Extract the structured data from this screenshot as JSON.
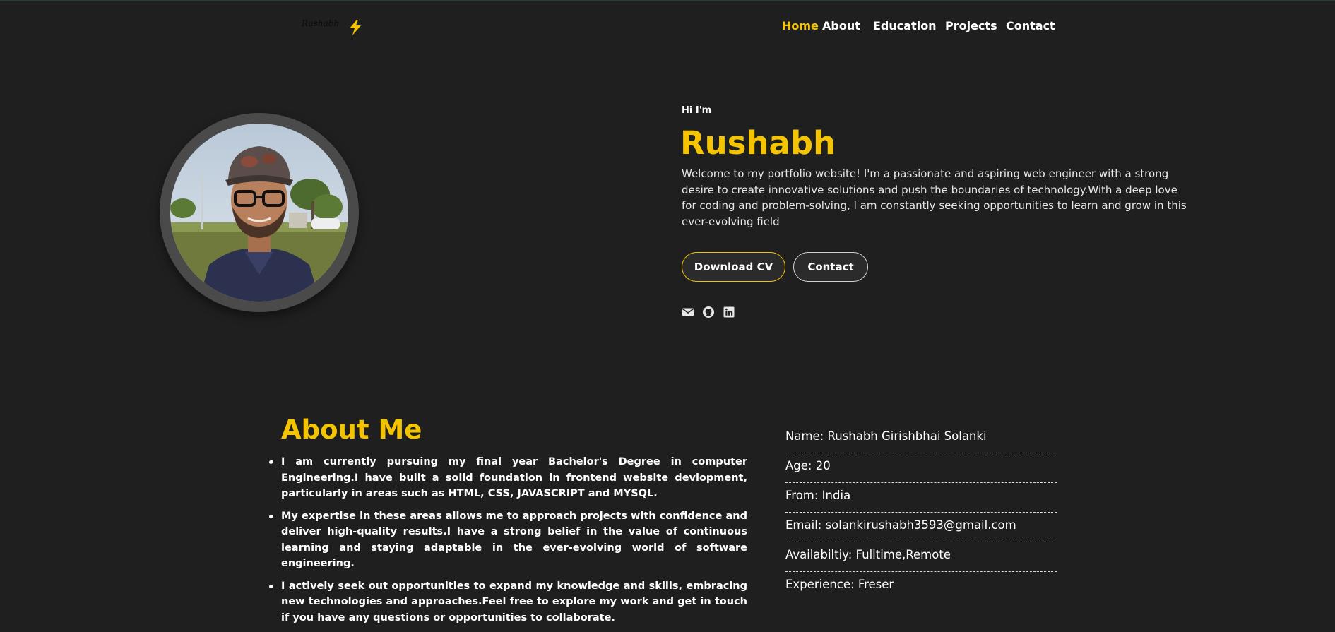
{
  "nav": {
    "logo_text": "Rushabh",
    "logo_icon": "lightning-bolt-icon",
    "links": [
      "Home",
      "About",
      "Education",
      "Projects",
      "Contact"
    ],
    "active": "Home"
  },
  "hero": {
    "greeting": "Hi I'm",
    "name": "Rushabh",
    "description": "Welcome to my portfolio website! I'm a passionate and aspiring web engineer with a strong desire to create innovative solutions and push the boundaries of technology.With a deep love for coding and problem-solving, I am constantly seeking opportunities to learn and grow in this ever-evolving field",
    "buttons": {
      "download_cv": "Download CV",
      "contact": "Contact"
    },
    "social_icons": [
      "envelope-icon",
      "github-icon",
      "linkedin-icon"
    ]
  },
  "about": {
    "title": "About Me",
    "items": [
      "I am currently pursuing my final year Bachelor's Degree in computer Engineering.I have built a solid foundation in frontend website devlopment, particularly in areas such as HTML, CSS, JAVASCRIPT and MYSQL.",
      "My expertise in these areas allows me to approach projects with confidence and deliver high-quality results.I have a strong belief in the value of continuous learning and staying adaptable in the ever-evolving world of software engineering.",
      "I actively seek out opportunities to expand my knowledge and skills, embracing new technologies and approaches.Feel free to explore my work and get in touch if you have any questions or opportunities to collaborate."
    ],
    "info": [
      "Name: Rushabh Girishbhai Solanki",
      "Age: 20",
      "From: India",
      "Email: solankirushabh3593@gmail.com",
      "Availabiltiy: Fulltime,Remote",
      "Experience: Freser"
    ]
  },
  "colors": {
    "accent": "#f5c400",
    "background": "#1f1f1f"
  }
}
